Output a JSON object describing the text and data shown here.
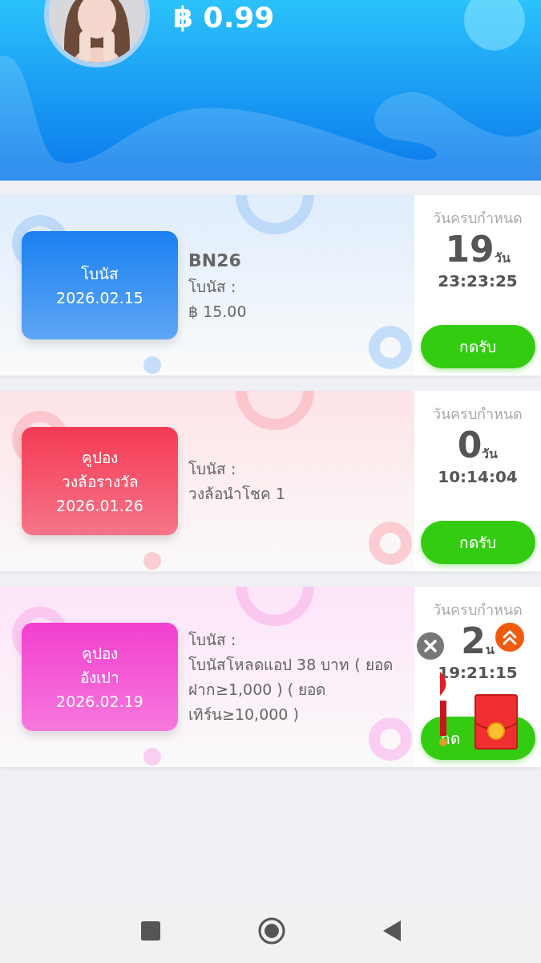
{
  "header": {
    "balance": "฿ 0.99"
  },
  "cards": [
    {
      "color": "#1a80f0",
      "badge": [
        "โบนัส",
        "2026.02.15"
      ],
      "title": "BN26",
      "label": "โบนัส :",
      "value": "฿ 15.00",
      "deadline_label": "วันครบกำหนด",
      "days": "19",
      "day_unit": "วัน",
      "time": "23:23:25",
      "button": "กดรับ"
    },
    {
      "color": "#f43a55",
      "badge": [
        "คูปอง",
        "วงล้อรางวัล",
        "2026.01.26"
      ],
      "label": "โบนัส :",
      "value": "วงล้อนำโชค 1",
      "deadline_label": "วันครบกำหนด",
      "days": "0",
      "day_unit": "วัน",
      "time": "10:14:04",
      "button": "กดรับ"
    },
    {
      "color": "#f23fcf",
      "badge": [
        "คูปอง",
        "อังเปา",
        "2026.02.19"
      ],
      "label": "โบนัส :",
      "value": "โบนัสโหลดแอป 38 บาท ( ยอดฝาก≥1,000 ) ( ยอดเทิร์น≥10,000 )",
      "deadline_label": "วันครบกำหนด",
      "days": "2",
      "day_unit": "น",
      "time": "19:21:15",
      "button": "กด"
    }
  ]
}
